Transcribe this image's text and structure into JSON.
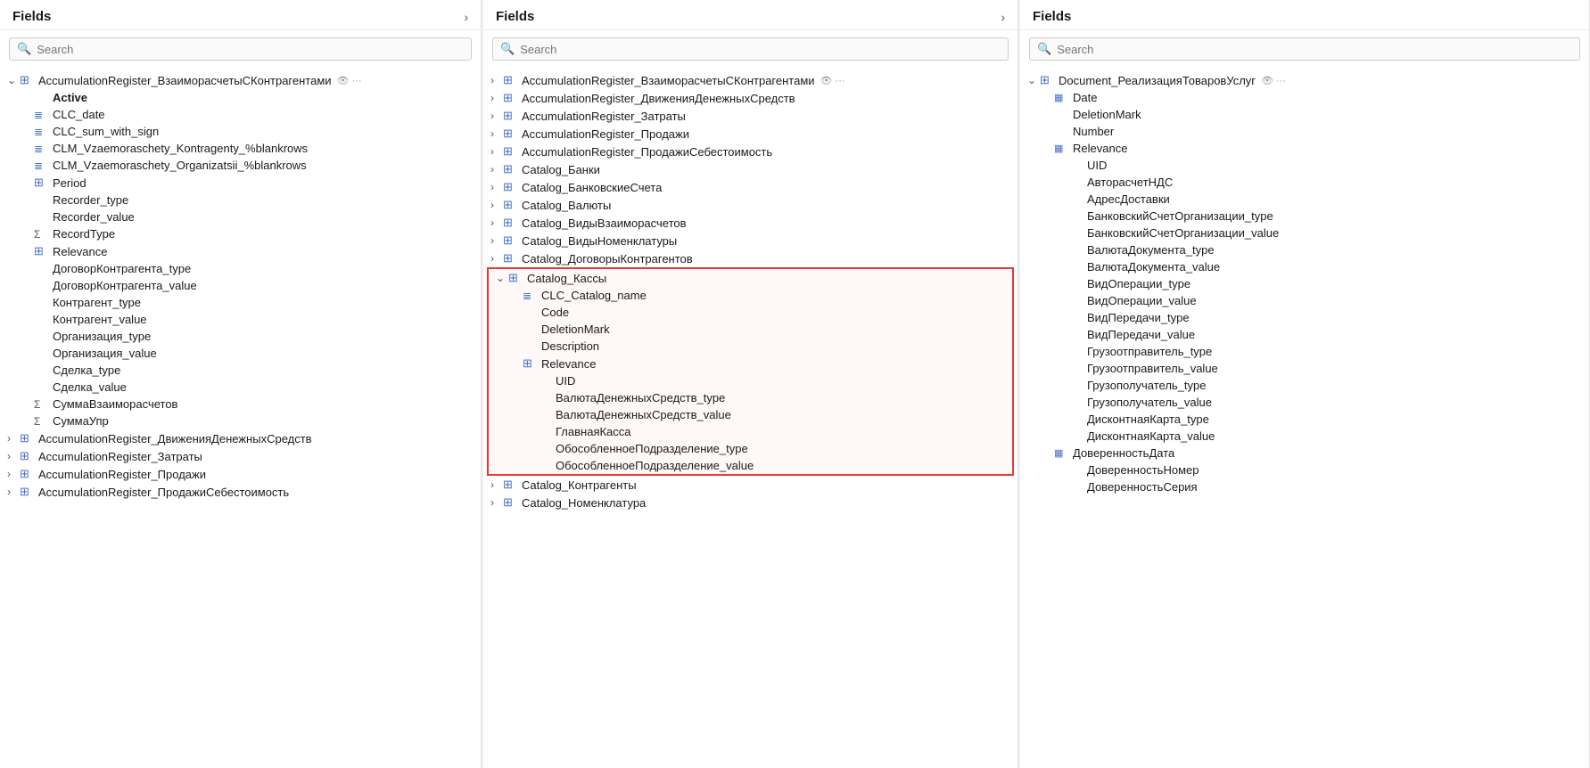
{
  "panels": [
    {
      "id": "left",
      "title": "Fields",
      "search_placeholder": "Search",
      "items": [
        {
          "level": 0,
          "chevron": "∨",
          "icon": "table",
          "label": "AccumulationRegister_ВзаиморасчетыСКонтрагентами",
          "extra": "👁 ···",
          "type": "root"
        },
        {
          "level": 1,
          "chevron": "",
          "icon": "",
          "label": "Active",
          "type": "leaf",
          "bold": true
        },
        {
          "level": 1,
          "chevron": "",
          "icon": "calc",
          "label": "CLC_date",
          "type": "leaf"
        },
        {
          "level": 1,
          "chevron": "",
          "icon": "calc",
          "label": "CLC_sum_with_sign",
          "type": "leaf"
        },
        {
          "level": 1,
          "chevron": "",
          "icon": "calc",
          "label": "CLM_Vzaemoraschety_Kontragenty_%blankrows",
          "type": "leaf"
        },
        {
          "level": 1,
          "chevron": "",
          "icon": "calc",
          "label": "CLM_Vzaemoraschety_Organizatsii_%blankrows",
          "type": "leaf"
        },
        {
          "level": 1,
          "chevron": "",
          "icon": "table",
          "label": "Period",
          "type": "leaf"
        },
        {
          "level": 1,
          "chevron": "",
          "icon": "",
          "label": "Recorder_type",
          "type": "leaf"
        },
        {
          "level": 1,
          "chevron": "",
          "icon": "",
          "label": "Recorder_value",
          "type": "leaf"
        },
        {
          "level": 1,
          "chevron": "",
          "icon": "sigma",
          "label": "RecordType",
          "type": "leaf"
        },
        {
          "level": 1,
          "chevron": "",
          "icon": "table",
          "label": "Relevance",
          "type": "leaf"
        },
        {
          "level": 1,
          "chevron": "",
          "icon": "",
          "label": "ДоговорКонтрагента_type",
          "type": "leaf"
        },
        {
          "level": 1,
          "chevron": "",
          "icon": "",
          "label": "ДоговорКонтрагента_value",
          "type": "leaf"
        },
        {
          "level": 1,
          "chevron": "",
          "icon": "",
          "label": "Контрагент_type",
          "type": "leaf"
        },
        {
          "level": 1,
          "chevron": "",
          "icon": "",
          "label": "Контрагент_value",
          "type": "leaf"
        },
        {
          "level": 1,
          "chevron": "",
          "icon": "",
          "label": "Организация_type",
          "type": "leaf"
        },
        {
          "level": 1,
          "chevron": "",
          "icon": "",
          "label": "Организация_value",
          "type": "leaf"
        },
        {
          "level": 1,
          "chevron": "",
          "icon": "",
          "label": "Сделка_type",
          "type": "leaf"
        },
        {
          "level": 1,
          "chevron": "",
          "icon": "",
          "label": "Сделка_value",
          "type": "leaf"
        },
        {
          "level": 1,
          "chevron": "",
          "icon": "sigma",
          "label": "СуммаВзаиморасчетов",
          "type": "leaf"
        },
        {
          "level": 1,
          "chevron": "",
          "icon": "sigma",
          "label": "СуммаУпр",
          "type": "leaf"
        },
        {
          "level": 0,
          "chevron": ">",
          "icon": "table",
          "label": "AccumulationRegister_ДвиженияДенежныхСредств",
          "type": "collapsed"
        },
        {
          "level": 0,
          "chevron": ">",
          "icon": "table",
          "label": "AccumulationRegister_Затраты",
          "type": "collapsed"
        },
        {
          "level": 0,
          "chevron": ">",
          "icon": "table",
          "label": "AccumulationRegister_Продажи",
          "type": "collapsed"
        },
        {
          "level": 0,
          "chevron": ">",
          "icon": "table",
          "label": "AccumulationRegister_ПродажиСебестоимость",
          "type": "collapsed"
        }
      ]
    },
    {
      "id": "middle",
      "title": "Fields",
      "search_placeholder": "Search",
      "items": [
        {
          "level": 0,
          "chevron": ">",
          "icon": "table",
          "label": "AccumulationRegister_ВзаиморасчетыСКонтрагентами",
          "extra": "👁 ···",
          "type": "collapsed"
        },
        {
          "level": 0,
          "chevron": ">",
          "icon": "table",
          "label": "AccumulationRegister_ДвиженияДенежныхСредств",
          "type": "collapsed"
        },
        {
          "level": 0,
          "chevron": ">",
          "icon": "table",
          "label": "AccumulationRegister_Затраты",
          "type": "collapsed"
        },
        {
          "level": 0,
          "chevron": ">",
          "icon": "table",
          "label": "AccumulationRegister_Продажи",
          "type": "collapsed"
        },
        {
          "level": 0,
          "chevron": ">",
          "icon": "table",
          "label": "AccumulationRegister_ПродажиСебестоимость",
          "type": "collapsed"
        },
        {
          "level": 0,
          "chevron": ">",
          "icon": "table",
          "label": "Catalog_Банки",
          "type": "collapsed"
        },
        {
          "level": 0,
          "chevron": ">",
          "icon": "table",
          "label": "Catalog_БанковскиеСчета",
          "type": "collapsed"
        },
        {
          "level": 0,
          "chevron": ">",
          "icon": "table",
          "label": "Catalog_Валюты",
          "type": "collapsed"
        },
        {
          "level": 0,
          "chevron": ">",
          "icon": "table",
          "label": "Catalog_ВидыВзаиморасчетов",
          "type": "collapsed"
        },
        {
          "level": 0,
          "chevron": ">",
          "icon": "table",
          "label": "Catalog_ВидыНоменклатуры",
          "type": "collapsed"
        },
        {
          "level": 0,
          "chevron": ">",
          "icon": "table",
          "label": "Catalog_ДоговорыКонтрагентов",
          "type": "collapsed"
        },
        {
          "level": 0,
          "chevron": "∨",
          "icon": "table",
          "label": "Catalog_Кассы",
          "type": "expanded",
          "highlighted": true
        },
        {
          "level": 1,
          "chevron": "",
          "icon": "calc",
          "label": "CLC_Catalog_name",
          "type": "leaf",
          "highlighted": true
        },
        {
          "level": 1,
          "chevron": "",
          "icon": "",
          "label": "Code",
          "type": "leaf",
          "highlighted": true
        },
        {
          "level": 1,
          "chevron": "",
          "icon": "",
          "label": "DeletionMark",
          "type": "leaf",
          "highlighted": true
        },
        {
          "level": 1,
          "chevron": "",
          "icon": "",
          "label": "Description",
          "type": "leaf",
          "highlighted": true
        },
        {
          "level": 1,
          "chevron": "",
          "icon": "table",
          "label": "Relevance",
          "type": "leaf",
          "highlighted": true
        },
        {
          "level": 2,
          "chevron": "",
          "icon": "",
          "label": "UID",
          "type": "leaf",
          "highlighted": true
        },
        {
          "level": 2,
          "chevron": "",
          "icon": "",
          "label": "ВалютаДенежныхСредств_type",
          "type": "leaf",
          "highlighted": true
        },
        {
          "level": 2,
          "chevron": "",
          "icon": "",
          "label": "ВалютаДенежныхСредств_value",
          "type": "leaf",
          "highlighted": true
        },
        {
          "level": 2,
          "chevron": "",
          "icon": "",
          "label": "ГлавнаяКасса",
          "type": "leaf",
          "highlighted": true
        },
        {
          "level": 2,
          "chevron": "",
          "icon": "",
          "label": "ОбособленноеПодразделение_type",
          "type": "leaf",
          "highlighted": true
        },
        {
          "level": 2,
          "chevron": "",
          "icon": "",
          "label": "ОбособленноеПодразделение_value",
          "type": "leaf",
          "highlighted": true
        },
        {
          "level": 0,
          "chevron": ">",
          "icon": "table",
          "label": "Catalog_Контрагенты",
          "type": "collapsed"
        },
        {
          "level": 0,
          "chevron": ">",
          "icon": "table",
          "label": "Catalog_Номенклатура",
          "type": "collapsed"
        }
      ]
    },
    {
      "id": "right",
      "title": "Fields",
      "search_placeholder": "Search",
      "items": [
        {
          "level": 0,
          "chevron": "∨",
          "icon": "table",
          "label": "Document_РеализацияТоваровУслуг",
          "extra": "👁 ···",
          "type": "expanded"
        },
        {
          "level": 1,
          "chevron": "",
          "icon": "calendar",
          "label": "Date",
          "type": "leaf"
        },
        {
          "level": 1,
          "chevron": "",
          "icon": "",
          "label": "DeletionMark",
          "type": "leaf"
        },
        {
          "level": 1,
          "chevron": "",
          "icon": "",
          "label": "Number",
          "type": "leaf"
        },
        {
          "level": 1,
          "chevron": "",
          "icon": "calendar",
          "label": "Relevance",
          "type": "leaf"
        },
        {
          "level": 2,
          "chevron": "",
          "icon": "",
          "label": "UID",
          "type": "leaf"
        },
        {
          "level": 2,
          "chevron": "",
          "icon": "",
          "label": "АвторасчетНДС",
          "type": "leaf"
        },
        {
          "level": 2,
          "chevron": "",
          "icon": "",
          "label": "АдресДоставки",
          "type": "leaf"
        },
        {
          "level": 2,
          "chevron": "",
          "icon": "",
          "label": "БанковскийСчетОрганизации_type",
          "type": "leaf"
        },
        {
          "level": 2,
          "chevron": "",
          "icon": "",
          "label": "БанковскийСчетОрганизации_value",
          "type": "leaf"
        },
        {
          "level": 2,
          "chevron": "",
          "icon": "",
          "label": "ВалютаДокумента_type",
          "type": "leaf"
        },
        {
          "level": 2,
          "chevron": "",
          "icon": "",
          "label": "ВалютаДокумента_value",
          "type": "leaf"
        },
        {
          "level": 2,
          "chevron": "",
          "icon": "",
          "label": "ВидОперации_type",
          "type": "leaf"
        },
        {
          "level": 2,
          "chevron": "",
          "icon": "",
          "label": "ВидОперации_value",
          "type": "leaf"
        },
        {
          "level": 2,
          "chevron": "",
          "icon": "",
          "label": "ВидПередачи_type",
          "type": "leaf"
        },
        {
          "level": 2,
          "chevron": "",
          "icon": "",
          "label": "ВидПередачи_value",
          "type": "leaf"
        },
        {
          "level": 2,
          "chevron": "",
          "icon": "",
          "label": "Грузоотправитель_type",
          "type": "leaf"
        },
        {
          "level": 2,
          "chevron": "",
          "icon": "",
          "label": "Грузоотправитель_value",
          "type": "leaf"
        },
        {
          "level": 2,
          "chevron": "",
          "icon": "",
          "label": "Грузополучатель_type",
          "type": "leaf"
        },
        {
          "level": 2,
          "chevron": "",
          "icon": "",
          "label": "Грузополучатель_value",
          "type": "leaf"
        },
        {
          "level": 2,
          "chevron": "",
          "icon": "",
          "label": "ДисконтнаяКарта_type",
          "type": "leaf"
        },
        {
          "level": 2,
          "chevron": "",
          "icon": "",
          "label": "ДисконтнаяКарта_value",
          "type": "leaf"
        },
        {
          "level": 1,
          "chevron": "",
          "icon": "calendar",
          "label": "ДоверенностьДата",
          "type": "leaf"
        },
        {
          "level": 2,
          "chevron": "",
          "icon": "",
          "label": "ДоверенностьНомер",
          "type": "leaf"
        },
        {
          "level": 2,
          "chevron": "",
          "icon": "",
          "label": "ДоверенностьСерия",
          "type": "leaf"
        }
      ]
    }
  ]
}
